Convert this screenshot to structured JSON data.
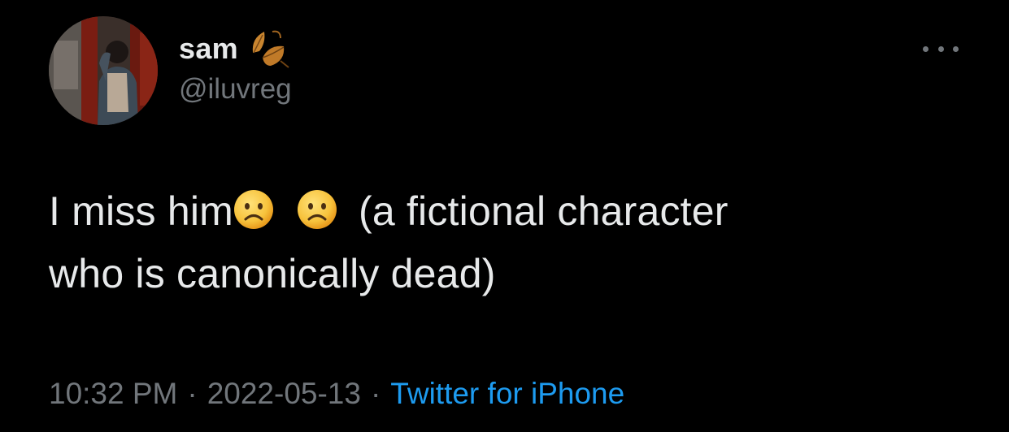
{
  "tweet": {
    "author": {
      "display_name": "sam",
      "handle": "@iluvreg",
      "name_icon": "autumn-leaves-icon",
      "avatar": "profile-photo"
    },
    "more_icon": "more-options-icon",
    "text": {
      "line1_start": "I miss him",
      "emoji": "frowning-face",
      "line1_end": "(a fictional character",
      "line2": "who is canonically dead)"
    },
    "meta": {
      "time": "10:32 PM",
      "separator": "·",
      "date": "2022-05-13",
      "source": "Twitter for iPhone"
    }
  },
  "colors": {
    "background": "#000000",
    "text": "#e7e9ea",
    "secondary": "#71767b",
    "link": "#1d9bf0"
  }
}
